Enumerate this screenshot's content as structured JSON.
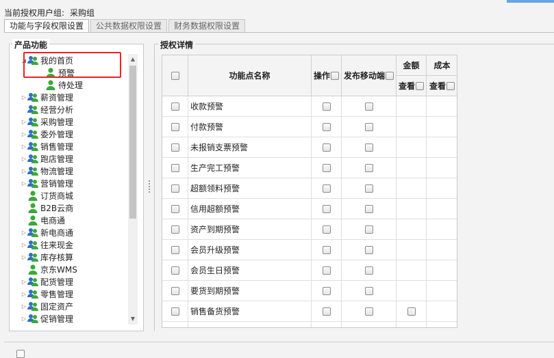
{
  "header": {
    "group_label": "当前授权用户组:",
    "group_value": "采购组"
  },
  "tabs": [
    {
      "label": "功能与字段权限设置",
      "active": true
    },
    {
      "label": "公共数据权限设置",
      "active": false
    },
    {
      "label": "财务数据权限设置",
      "active": false
    }
  ],
  "left_panel": {
    "legend": "产品功能",
    "tree": [
      {
        "label": "我的首页",
        "level": 0,
        "expander": "expanded",
        "icon": "user-group-icon"
      },
      {
        "label": "预警",
        "level": 1,
        "expander": "none",
        "icon": "user-icon",
        "selected": true
      },
      {
        "label": "待处理",
        "level": 1,
        "expander": "none",
        "icon": "user-icon"
      },
      {
        "label": "薪资管理",
        "level": 0,
        "expander": "collapsed",
        "icon": "user-group-icon"
      },
      {
        "label": "经营分析",
        "level": 0,
        "expander": "none",
        "icon": "user-group-icon"
      },
      {
        "label": "采购管理",
        "level": 0,
        "expander": "collapsed",
        "icon": "user-group-icon"
      },
      {
        "label": "委外管理",
        "level": 0,
        "expander": "collapsed",
        "icon": "user-group-icon"
      },
      {
        "label": "销售管理",
        "level": 0,
        "expander": "collapsed",
        "icon": "user-group-icon"
      },
      {
        "label": "跑店管理",
        "level": 0,
        "expander": "collapsed",
        "icon": "user-group-icon"
      },
      {
        "label": "物流管理",
        "level": 0,
        "expander": "collapsed",
        "icon": "user-group-icon"
      },
      {
        "label": "营销管理",
        "level": 0,
        "expander": "collapsed",
        "icon": "user-group-icon"
      },
      {
        "label": "订货商城",
        "level": 0,
        "expander": "none",
        "icon": "user-icon"
      },
      {
        "label": "B2B云商",
        "level": 0,
        "expander": "none",
        "icon": "user-icon"
      },
      {
        "label": "电商通",
        "level": 0,
        "expander": "none",
        "icon": "user-icon"
      },
      {
        "label": "新电商通",
        "level": 0,
        "expander": "collapsed",
        "icon": "user-group-icon"
      },
      {
        "label": "往来现金",
        "level": 0,
        "expander": "collapsed",
        "icon": "user-group-icon"
      },
      {
        "label": "库存核算",
        "level": 0,
        "expander": "collapsed",
        "icon": "user-group-icon"
      },
      {
        "label": "京东WMS",
        "level": 0,
        "expander": "none",
        "icon": "user-icon"
      },
      {
        "label": "配货管理",
        "level": 0,
        "expander": "collapsed",
        "icon": "user-group-icon"
      },
      {
        "label": "零售管理",
        "level": 0,
        "expander": "collapsed",
        "icon": "user-group-icon"
      },
      {
        "label": "固定资产",
        "level": 0,
        "expander": "collapsed",
        "icon": "user-group-icon"
      },
      {
        "label": "促销管理",
        "level": 0,
        "expander": "collapsed",
        "icon": "user-group-icon"
      }
    ]
  },
  "right_panel": {
    "legend": "授权详情",
    "columns": {
      "name": "功能点名称",
      "operate": "操作",
      "mobile": "发布移动端",
      "amount": "金额",
      "cost": "成本",
      "amount_view": "查看",
      "cost_view": "查看"
    },
    "rows": [
      {
        "name": "收款预警",
        "amount_view": false
      },
      {
        "name": "付款预警",
        "amount_view": false
      },
      {
        "name": "未报销支票预警",
        "amount_view": false
      },
      {
        "name": "生产完工预警",
        "amount_view": false
      },
      {
        "name": "超额领料预警",
        "amount_view": false
      },
      {
        "name": "信用超额预警",
        "amount_view": false
      },
      {
        "name": "资产到期预警",
        "amount_view": false
      },
      {
        "name": "会员升级预警",
        "amount_view": false
      },
      {
        "name": "会员生日预警",
        "amount_view": false
      },
      {
        "name": "要货到期预警",
        "amount_view": false
      },
      {
        "name": "销售备货预警",
        "amount_view": true
      }
    ]
  },
  "colors": {
    "highlight": "#e22222",
    "icon_green": "#3aa83a",
    "icon_blue": "#2f6fc4"
  }
}
